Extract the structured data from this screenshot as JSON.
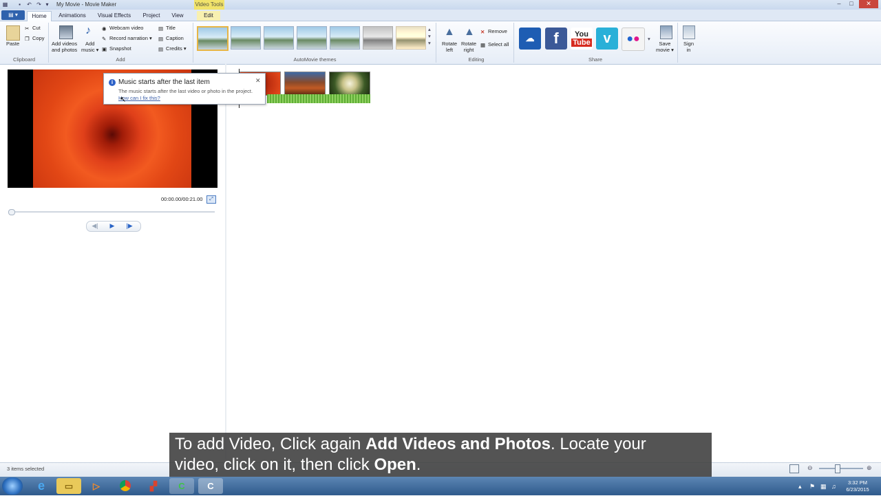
{
  "window": {
    "title": "My Movie - Movie Maker",
    "context_tab_label": "Video Tools"
  },
  "tabs": [
    {
      "label": "Home"
    },
    {
      "label": "Animations"
    },
    {
      "label": "Visual Effects"
    },
    {
      "label": "Project"
    },
    {
      "label": "View"
    },
    {
      "label": "Edit"
    }
  ],
  "ribbon": {
    "clipboard": {
      "paste": "Paste",
      "cut": "Cut",
      "copy": "Copy",
      "group": "Clipboard"
    },
    "add": {
      "add_videos_line1": "Add videos",
      "add_videos_line2": "and photos",
      "add_music_line1": "Add",
      "add_music_line2": "music",
      "webcam": "Webcam video",
      "record_narration": "Record narration",
      "snapshot": "Snapshot",
      "title": "Title",
      "caption": "Caption",
      "credits": "Credits",
      "group": "Add"
    },
    "themes": {
      "group": "AutoMovie themes"
    },
    "editing": {
      "rotate_left_line1": "Rotate",
      "rotate_left_line2": "left",
      "rotate_right_line1": "Rotate",
      "rotate_right_line2": "right",
      "remove": "Remove",
      "select_all": "Select all",
      "group": "Editing"
    },
    "share": {
      "youtube_line1": "You",
      "youtube_line2": "Tube",
      "save_movie_line1": "Save",
      "save_movie_line2": "movie",
      "sign_in_line1": "Sign",
      "sign_in_line2": "in",
      "group": "Share"
    }
  },
  "preview": {
    "timecode": "00:00.00/00:21.00"
  },
  "balloon": {
    "title": "Music starts after the last item",
    "text": "The music starts after the last video or photo in the project.",
    "link": "How can I fix this?"
  },
  "status": {
    "text": "3 items selected"
  },
  "caption": {
    "line1_a": "To add Video, Click again ",
    "line1_b": "Add Videos and Photos",
    "line1_c": ". Locate your",
    "line2_a": "video, click on it, then click ",
    "line2_b": "Open",
    "line2_c": "."
  },
  "taskbar": {
    "time": "3:32 PM",
    "date": "6/23/2015"
  },
  "colors": {
    "accent": "#2f62ad",
    "context_tab": "#f1e36a",
    "music_strip": "#5fae36"
  }
}
